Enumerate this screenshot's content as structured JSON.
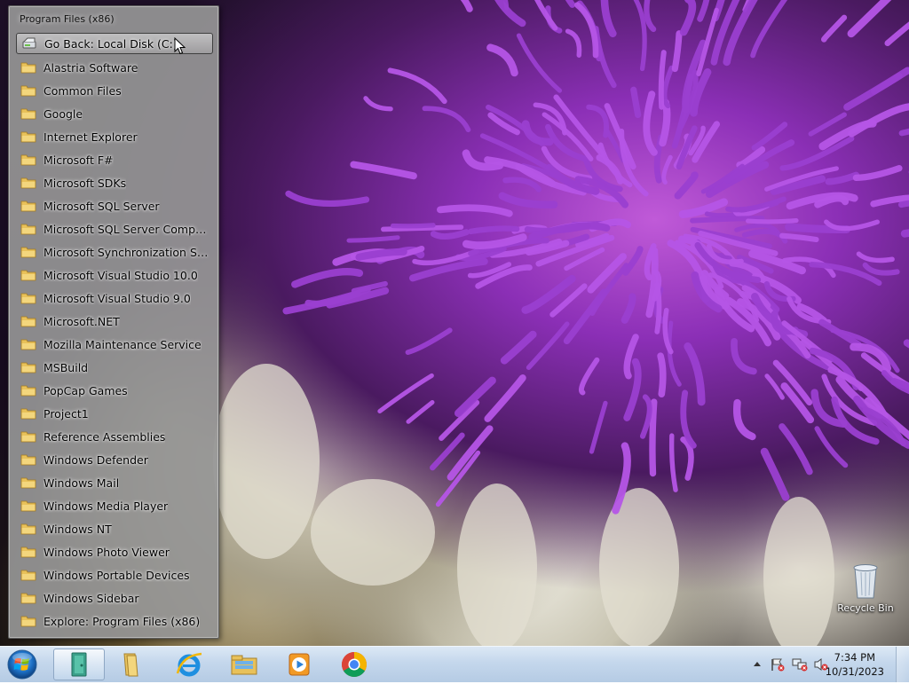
{
  "menu": {
    "title": "Program Files (x86)",
    "items": [
      {
        "label": "Go Back: Local Disk (C:)",
        "icon": "go-back-drive-icon",
        "name": "menu-item-go-back"
      },
      {
        "label": "Alastria Software",
        "icon": "folder-icon",
        "name": "menu-item-alastria-software"
      },
      {
        "label": "Common Files",
        "icon": "folder-icon",
        "name": "menu-item-common-files"
      },
      {
        "label": "Google",
        "icon": "folder-icon",
        "name": "menu-item-google"
      },
      {
        "label": "Internet Explorer",
        "icon": "folder-icon",
        "name": "menu-item-internet-explorer"
      },
      {
        "label": "Microsoft F#",
        "icon": "folder-icon",
        "name": "menu-item-microsoft-fsharp"
      },
      {
        "label": "Microsoft SDKs",
        "icon": "folder-icon",
        "name": "menu-item-microsoft-sdks"
      },
      {
        "label": "Microsoft SQL Server",
        "icon": "folder-icon",
        "name": "menu-item-microsoft-sql-server"
      },
      {
        "label": "Microsoft SQL Server Compa...",
        "icon": "folder-icon",
        "name": "menu-item-microsoft-sql-server-compact"
      },
      {
        "label": "Microsoft Synchronization Se...",
        "icon": "folder-icon",
        "name": "menu-item-microsoft-synchronization"
      },
      {
        "label": "Microsoft Visual Studio 10.0",
        "icon": "folder-icon",
        "name": "menu-item-visual-studio-10"
      },
      {
        "label": "Microsoft Visual Studio 9.0",
        "icon": "folder-icon",
        "name": "menu-item-visual-studio-9"
      },
      {
        "label": "Microsoft.NET",
        "icon": "folder-icon",
        "name": "menu-item-microsoft-net"
      },
      {
        "label": "Mozilla Maintenance Service",
        "icon": "folder-icon",
        "name": "menu-item-mozilla-maintenance"
      },
      {
        "label": "MSBuild",
        "icon": "folder-icon",
        "name": "menu-item-msbuild"
      },
      {
        "label": "PopCap Games",
        "icon": "folder-icon",
        "name": "menu-item-popcap-games"
      },
      {
        "label": "Project1",
        "icon": "folder-icon",
        "name": "menu-item-project1"
      },
      {
        "label": "Reference Assemblies",
        "icon": "folder-icon",
        "name": "menu-item-reference-assemblies"
      },
      {
        "label": "Windows Defender",
        "icon": "folder-icon",
        "name": "menu-item-windows-defender"
      },
      {
        "label": "Windows Mail",
        "icon": "folder-icon",
        "name": "menu-item-windows-mail"
      },
      {
        "label": "Windows Media Player",
        "icon": "folder-icon",
        "name": "menu-item-windows-media-player"
      },
      {
        "label": "Windows NT",
        "icon": "folder-icon",
        "name": "menu-item-windows-nt"
      },
      {
        "label": "Windows Photo Viewer",
        "icon": "folder-icon",
        "name": "menu-item-windows-photo-viewer"
      },
      {
        "label": "Windows Portable Devices",
        "icon": "folder-icon",
        "name": "menu-item-windows-portable-devices"
      },
      {
        "label": "Windows Sidebar",
        "icon": "folder-icon",
        "name": "menu-item-windows-sidebar"
      },
      {
        "label": "Explore: Program Files (x86)",
        "icon": "folder-icon",
        "name": "menu-item-explore-program-files"
      }
    ],
    "hovered_index": 0
  },
  "desktop": {
    "recycle_bin_label": "Recycle Bin"
  },
  "taskbar": {
    "pinned": [
      {
        "name": "taskbar-active-app",
        "icon": "green-app-icon",
        "active": true
      },
      {
        "name": "taskbar-file-explorer",
        "icon": "folder-library-icon",
        "active": false
      },
      {
        "name": "taskbar-internet-explorer",
        "icon": "internet-explorer-icon",
        "active": false
      },
      {
        "name": "taskbar-windows-explorer",
        "icon": "windows-explorer-icon",
        "active": false
      },
      {
        "name": "taskbar-media-player",
        "icon": "media-player-icon",
        "active": false
      },
      {
        "name": "taskbar-chrome",
        "icon": "chrome-icon",
        "active": false
      }
    ],
    "clock": {
      "time": "7:34 PM",
      "date": "10/31/2023"
    }
  },
  "colors": {
    "taskbar_top": "#dce8f5",
    "taskbar_bottom": "#b5cbe4",
    "menu_bg": "#969696",
    "folder_yellow": "#e8c15a"
  }
}
